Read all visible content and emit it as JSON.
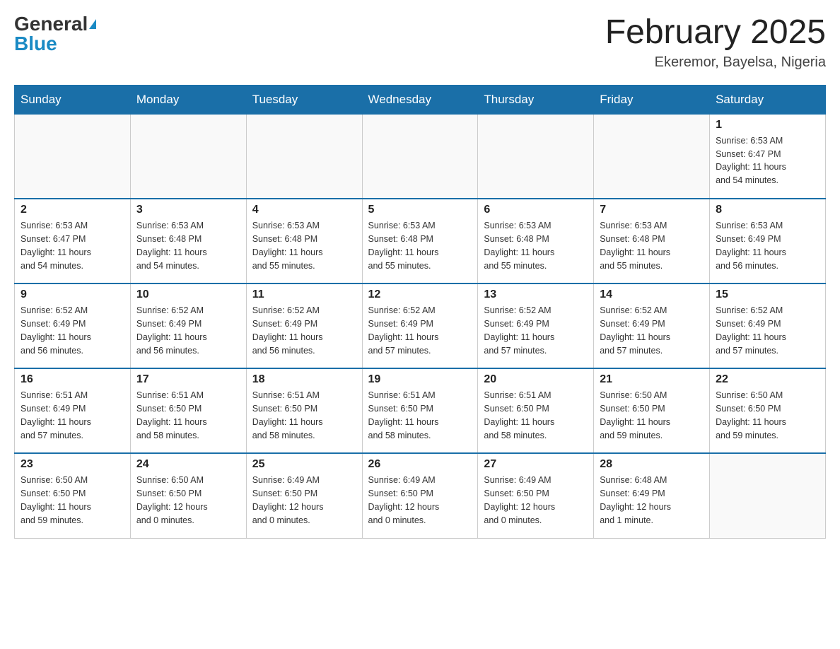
{
  "header": {
    "logo_general": "General",
    "logo_blue": "Blue",
    "month_title": "February 2025",
    "location": "Ekeremor, Bayelsa, Nigeria"
  },
  "days_of_week": [
    "Sunday",
    "Monday",
    "Tuesday",
    "Wednesday",
    "Thursday",
    "Friday",
    "Saturday"
  ],
  "weeks": [
    [
      {
        "day": "",
        "info": ""
      },
      {
        "day": "",
        "info": ""
      },
      {
        "day": "",
        "info": ""
      },
      {
        "day": "",
        "info": ""
      },
      {
        "day": "",
        "info": ""
      },
      {
        "day": "",
        "info": ""
      },
      {
        "day": "1",
        "info": "Sunrise: 6:53 AM\nSunset: 6:47 PM\nDaylight: 11 hours\nand 54 minutes."
      }
    ],
    [
      {
        "day": "2",
        "info": "Sunrise: 6:53 AM\nSunset: 6:47 PM\nDaylight: 11 hours\nand 54 minutes."
      },
      {
        "day": "3",
        "info": "Sunrise: 6:53 AM\nSunset: 6:48 PM\nDaylight: 11 hours\nand 54 minutes."
      },
      {
        "day": "4",
        "info": "Sunrise: 6:53 AM\nSunset: 6:48 PM\nDaylight: 11 hours\nand 55 minutes."
      },
      {
        "day": "5",
        "info": "Sunrise: 6:53 AM\nSunset: 6:48 PM\nDaylight: 11 hours\nand 55 minutes."
      },
      {
        "day": "6",
        "info": "Sunrise: 6:53 AM\nSunset: 6:48 PM\nDaylight: 11 hours\nand 55 minutes."
      },
      {
        "day": "7",
        "info": "Sunrise: 6:53 AM\nSunset: 6:48 PM\nDaylight: 11 hours\nand 55 minutes."
      },
      {
        "day": "8",
        "info": "Sunrise: 6:53 AM\nSunset: 6:49 PM\nDaylight: 11 hours\nand 56 minutes."
      }
    ],
    [
      {
        "day": "9",
        "info": "Sunrise: 6:52 AM\nSunset: 6:49 PM\nDaylight: 11 hours\nand 56 minutes."
      },
      {
        "day": "10",
        "info": "Sunrise: 6:52 AM\nSunset: 6:49 PM\nDaylight: 11 hours\nand 56 minutes."
      },
      {
        "day": "11",
        "info": "Sunrise: 6:52 AM\nSunset: 6:49 PM\nDaylight: 11 hours\nand 56 minutes."
      },
      {
        "day": "12",
        "info": "Sunrise: 6:52 AM\nSunset: 6:49 PM\nDaylight: 11 hours\nand 57 minutes."
      },
      {
        "day": "13",
        "info": "Sunrise: 6:52 AM\nSunset: 6:49 PM\nDaylight: 11 hours\nand 57 minutes."
      },
      {
        "day": "14",
        "info": "Sunrise: 6:52 AM\nSunset: 6:49 PM\nDaylight: 11 hours\nand 57 minutes."
      },
      {
        "day": "15",
        "info": "Sunrise: 6:52 AM\nSunset: 6:49 PM\nDaylight: 11 hours\nand 57 minutes."
      }
    ],
    [
      {
        "day": "16",
        "info": "Sunrise: 6:51 AM\nSunset: 6:49 PM\nDaylight: 11 hours\nand 57 minutes."
      },
      {
        "day": "17",
        "info": "Sunrise: 6:51 AM\nSunset: 6:50 PM\nDaylight: 11 hours\nand 58 minutes."
      },
      {
        "day": "18",
        "info": "Sunrise: 6:51 AM\nSunset: 6:50 PM\nDaylight: 11 hours\nand 58 minutes."
      },
      {
        "day": "19",
        "info": "Sunrise: 6:51 AM\nSunset: 6:50 PM\nDaylight: 11 hours\nand 58 minutes."
      },
      {
        "day": "20",
        "info": "Sunrise: 6:51 AM\nSunset: 6:50 PM\nDaylight: 11 hours\nand 58 minutes."
      },
      {
        "day": "21",
        "info": "Sunrise: 6:50 AM\nSunset: 6:50 PM\nDaylight: 11 hours\nand 59 minutes."
      },
      {
        "day": "22",
        "info": "Sunrise: 6:50 AM\nSunset: 6:50 PM\nDaylight: 11 hours\nand 59 minutes."
      }
    ],
    [
      {
        "day": "23",
        "info": "Sunrise: 6:50 AM\nSunset: 6:50 PM\nDaylight: 11 hours\nand 59 minutes."
      },
      {
        "day": "24",
        "info": "Sunrise: 6:50 AM\nSunset: 6:50 PM\nDaylight: 12 hours\nand 0 minutes."
      },
      {
        "day": "25",
        "info": "Sunrise: 6:49 AM\nSunset: 6:50 PM\nDaylight: 12 hours\nand 0 minutes."
      },
      {
        "day": "26",
        "info": "Sunrise: 6:49 AM\nSunset: 6:50 PM\nDaylight: 12 hours\nand 0 minutes."
      },
      {
        "day": "27",
        "info": "Sunrise: 6:49 AM\nSunset: 6:50 PM\nDaylight: 12 hours\nand 0 minutes."
      },
      {
        "day": "28",
        "info": "Sunrise: 6:48 AM\nSunset: 6:49 PM\nDaylight: 12 hours\nand 1 minute."
      },
      {
        "day": "",
        "info": ""
      }
    ]
  ]
}
